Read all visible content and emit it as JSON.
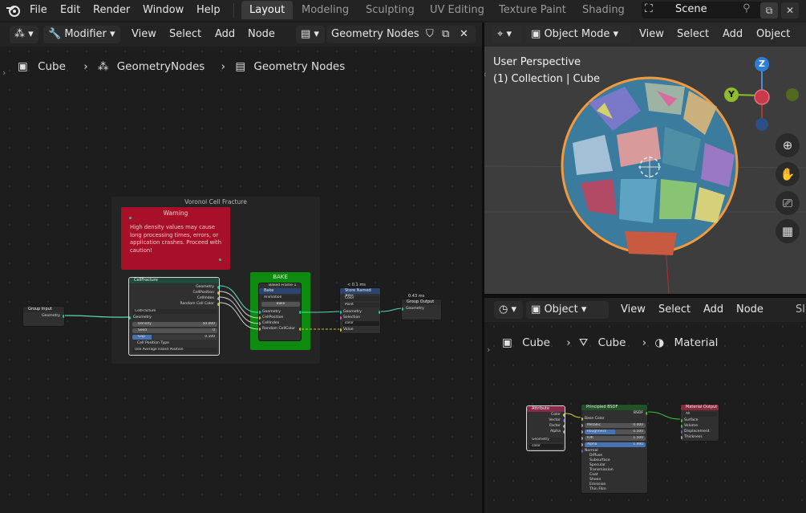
{
  "menu": [
    "File",
    "Edit",
    "Render",
    "Window",
    "Help"
  ],
  "workspaces": [
    "Layout",
    "Modeling",
    "Sculpting",
    "UV Editing",
    "Texture Paint",
    "Shading"
  ],
  "active_workspace": "Layout",
  "scene": "Scene",
  "geo_editor": {
    "header": {
      "modifier": "Modifier",
      "menus": [
        "View",
        "Select",
        "Add",
        "Node"
      ],
      "tree_name": "Geometry Nodes"
    },
    "breadcrumb": [
      "Cube",
      "GeometryNodes",
      "Geometry Nodes"
    ],
    "frame_title": "Voronoi Cell Fracture",
    "warning": {
      "title": "Warning",
      "text": "High density values may cause long processing times, errors, or application crashes. Proceed with caution!"
    },
    "group_input": {
      "title": "Group Input",
      "socket": "Geometry"
    },
    "cell_node": {
      "title": "CellFracture",
      "outputs": [
        "Geometry",
        "CellPosition",
        "CellIndex",
        "Random Cell Color"
      ],
      "group": "CellFracture",
      "input_geometry": "Geometry",
      "density_label": "Density",
      "density_value": "50.000",
      "seed_label": "Seed",
      "seed_value": "0",
      "gap_label": "Gap",
      "gap_value": "0.100",
      "type_label": "Cell Position Type",
      "type_value": "Use Average Island Position"
    },
    "bake": {
      "title": "BAKE",
      "sub": "Baked Frame 1",
      "bake_label": "Bake",
      "animation": "Animation",
      "bake_btn": "Bake",
      "rows": [
        "Geometry",
        "CellPosition",
        "CellIndex",
        "Random CellColor"
      ]
    },
    "store": {
      "time": "< 0.1 ms",
      "title": "Store Named Attri...",
      "type": "Color",
      "domain": "Point",
      "rows": [
        "Geometry",
        "Selection"
      ],
      "name_value": "color",
      "value_label": "Value"
    },
    "group_output": {
      "time": "0.43 ms",
      "title": "Group Output",
      "socket": "Geometry"
    }
  },
  "viewport": {
    "header": {
      "mode": "Object Mode",
      "menus": [
        "View",
        "Select",
        "Add",
        "Object"
      ]
    },
    "label1": "User Perspective",
    "label2": "(1) Collection | Cube",
    "axes": {
      "z": "Z",
      "y": "Y"
    }
  },
  "shader_editor": {
    "header": {
      "type": "Object",
      "menus": [
        "View",
        "Select",
        "Add",
        "Node"
      ],
      "extra": "Sl"
    },
    "breadcrumb": [
      "Cube",
      "Cube",
      "Material"
    ],
    "attribute": {
      "title": "Attribute",
      "outputs": [
        "Color",
        "Vector",
        "Factor",
        "Alpha"
      ],
      "type": "Geometry",
      "name": "color"
    },
    "bsdf": {
      "title": "Principled BSDF",
      "out": "BSDF",
      "base_color": "Base Color",
      "fields": [
        {
          "label": "Metallic",
          "value": "0.000"
        },
        {
          "label": "Roughness",
          "value": "0.500"
        },
        {
          "label": "IOR",
          "value": "1.500"
        },
        {
          "label": "Alpha",
          "value": "1.000"
        }
      ],
      "normal": "Normal",
      "panels": [
        "Diffuse",
        "Subsurface",
        "Specular",
        "Transmission",
        "Coat",
        "Sheen",
        "Emission",
        "Thin Film"
      ]
    },
    "mat_output": {
      "title": "Material Output",
      "target": "All",
      "inputs": [
        "Surface",
        "Volume",
        "Displacement",
        "Thickness"
      ]
    }
  },
  "colors": {
    "accent": "#4772b3",
    "warning": "#a8102a",
    "bake_frame": "#0e8a0e",
    "geometry_socket": "#00d6a3",
    "frame": "#242424"
  }
}
